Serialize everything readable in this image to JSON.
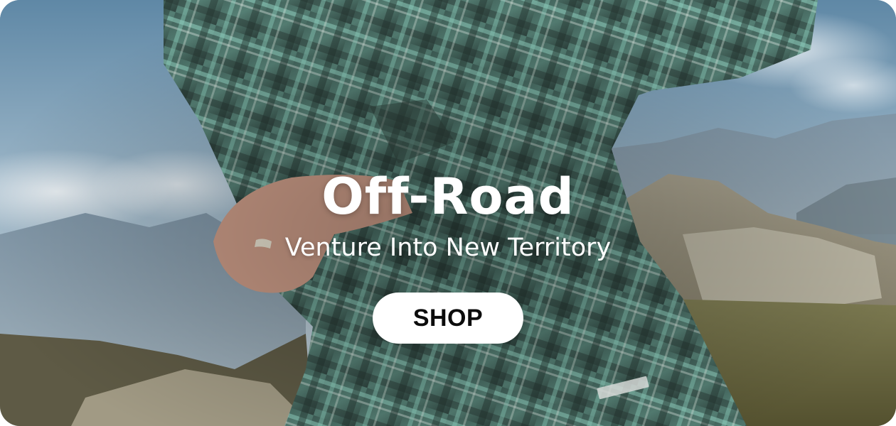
{
  "hero": {
    "headline": "Off-Road",
    "subheadline": "Venture Into New Territory",
    "cta_label": "SHOP"
  },
  "theme": {
    "text_color": "#ffffff",
    "button_bg": "#ffffff",
    "button_text": "#0c0c0c",
    "plaid_primary": "#4e7f74",
    "plaid_accent": "#8fd0bf"
  }
}
